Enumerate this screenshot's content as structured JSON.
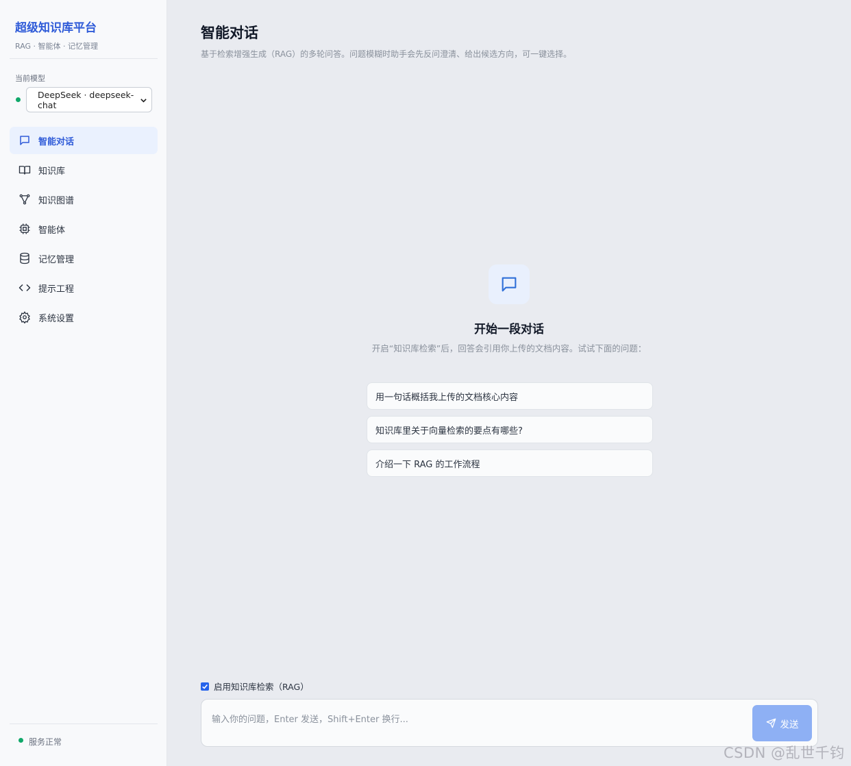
{
  "brand": {
    "title": "超级知识库平台",
    "subtitle": "RAG · 智能体 · 记忆管理"
  },
  "model": {
    "label": "当前模型",
    "selected": "DeepSeek · deepseek-chat",
    "status_color": "#10a86a"
  },
  "nav": [
    {
      "label": "智能对话",
      "icon": "chat-bubble-icon",
      "active": true
    },
    {
      "label": "知识库",
      "icon": "book-icon",
      "active": false
    },
    {
      "label": "知识图谱",
      "icon": "graph-icon",
      "active": false
    },
    {
      "label": "智能体",
      "icon": "cpu-chip-icon",
      "active": false
    },
    {
      "label": "记忆管理",
      "icon": "database-icon",
      "active": false
    },
    {
      "label": "提示工程",
      "icon": "code-brackets-icon",
      "active": false
    },
    {
      "label": "系统设置",
      "icon": "gear-icon",
      "active": false
    }
  ],
  "service_status": "服务正常",
  "page": {
    "title": "智能对话",
    "subtitle": "基于检索增强生成（RAG）的多轮问答。问题模糊时助手会先反问澄清、给出候选方向，可一键选择。"
  },
  "empty_state": {
    "title": "开始一段对话",
    "description": "开启“知识库检索”后，回答会引用你上传的文档内容。试试下面的问题："
  },
  "suggestions": [
    "用一句话概括我上传的文档核心内容",
    "知识库里关于向量检索的要点有哪些?",
    "介绍一下 RAG 的工作流程"
  ],
  "composer": {
    "rag_toggle_label": "启用知识库检索（RAG）",
    "rag_enabled": true,
    "placeholder": "输入你的问题，Enter 发送，Shift+Enter 换行...",
    "send_label": "发送"
  },
  "watermark": "CSDN @乱世千钧",
  "colors": {
    "accent": "#2f5bd8",
    "active_bg": "#eaf1fe",
    "send_button": "#8eb0f4"
  }
}
